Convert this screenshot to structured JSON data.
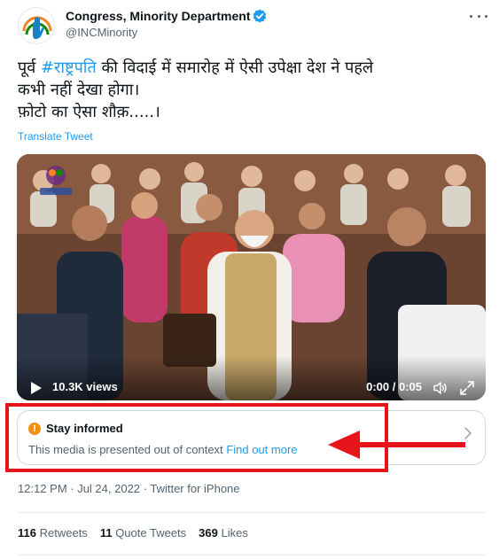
{
  "account": {
    "display_name": "Congress, Minority Department",
    "handle": "@INCMinority",
    "avatar_icon": "congress-hand-logo",
    "verified_icon": "verified-badge-icon"
  },
  "tweet": {
    "line1_prefix": "पूर्व ",
    "hashtag": "#राष्ट्रपति",
    "line1_suffix": " की विदाई में समारोह में ऐसी उपेक्षा  देश ने पहले",
    "line2": "कभी नहीं देखा होगा।",
    "line3": "फ़ोटो का ऐसा शौक़.....।",
    "translate_label": "Translate Tweet"
  },
  "video": {
    "views": "10.3K views",
    "time": "0:00 / 0:05",
    "play_icon": "play-icon",
    "volume_icon": "volume-icon",
    "fullscreen_icon": "fullscreen-icon"
  },
  "notice": {
    "title": "Stay informed",
    "body": "This media is presented out of context",
    "link": "Find out more",
    "icon": "warning-icon"
  },
  "meta": {
    "timestamp": "12:12 PM · Jul 24, 2022 · Twitter for iPhone"
  },
  "stats": {
    "retweets_count": "116",
    "retweets_label": "Retweets",
    "quotes_count": "11",
    "quotes_label": "Quote Tweets",
    "likes_count": "369",
    "likes_label": "Likes"
  },
  "colors": {
    "accent": "#1d9bf0",
    "highlight": "#e8141c",
    "warning": "#f4900c"
  }
}
